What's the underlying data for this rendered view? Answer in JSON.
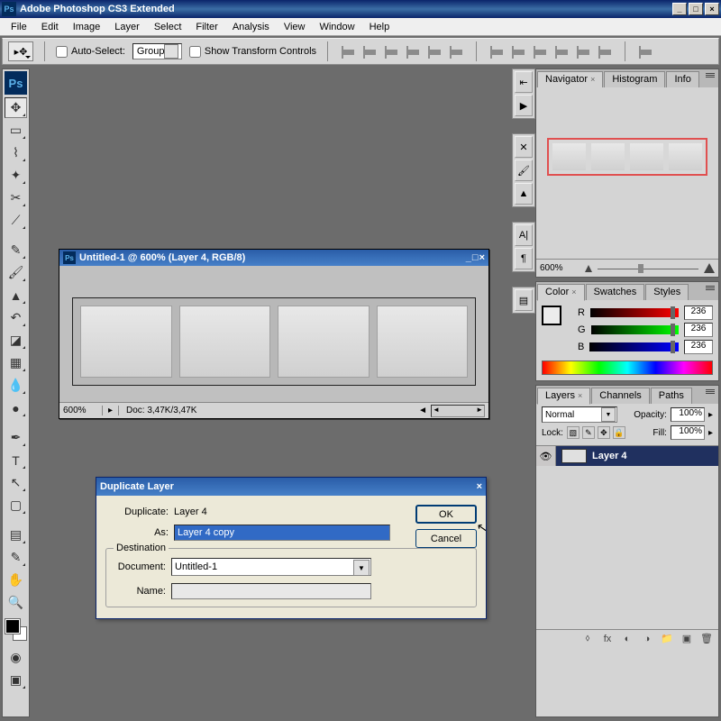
{
  "app": {
    "title": "Adobe Photoshop CS3 Extended",
    "logo": "Ps"
  },
  "menu": [
    "File",
    "Edit",
    "Image",
    "Layer",
    "Select",
    "Filter",
    "Analysis",
    "View",
    "Window",
    "Help"
  ],
  "options": {
    "auto_select_label": "Auto-Select:",
    "auto_select_value": "Group",
    "show_transform_label": "Show Transform Controls"
  },
  "document": {
    "title": "Untitled-1 @ 600% (Layer 4, RGB/8)",
    "zoom": "600%",
    "doc_size": "Doc: 3,47K/3,47K"
  },
  "dialog": {
    "title": "Duplicate Layer",
    "duplicate_label": "Duplicate:",
    "duplicate_value": "Layer 4",
    "as_label": "As:",
    "as_value": "Layer 4 copy",
    "destination_label": "Destination",
    "document_label": "Document:",
    "document_value": "Untitled-1",
    "name_label": "Name:",
    "name_value": "",
    "ok": "OK",
    "cancel": "Cancel"
  },
  "navigator": {
    "tabs": [
      "Navigator",
      "Histogram",
      "Info"
    ],
    "zoom": "600%"
  },
  "color": {
    "tabs": [
      "Color",
      "Swatches",
      "Styles"
    ],
    "r_label": "R",
    "r_value": "236",
    "g_label": "G",
    "g_value": "236",
    "b_label": "B",
    "b_value": "236"
  },
  "layers": {
    "tabs": [
      "Layers",
      "Channels",
      "Paths"
    ],
    "blend_mode": "Normal",
    "opacity_label": "Opacity:",
    "opacity_value": "100%",
    "lock_label": "Lock:",
    "fill_label": "Fill:",
    "fill_value": "100%",
    "layer_name": "Layer 4"
  }
}
